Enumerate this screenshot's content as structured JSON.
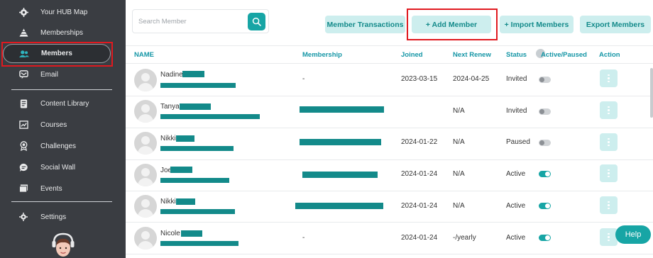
{
  "sidebar": {
    "items": [
      {
        "label": "Your HUB Map",
        "icon": "gear-icon"
      },
      {
        "label": "Memberships",
        "icon": "pyramid-icon"
      },
      {
        "label": "Members",
        "icon": "users-icon"
      },
      {
        "label": "Email",
        "icon": "email-icon"
      },
      {
        "label": "Content Library",
        "icon": "document-icon"
      },
      {
        "label": "Courses",
        "icon": "courses-icon"
      },
      {
        "label": "Challenges",
        "icon": "award-icon"
      },
      {
        "label": "Social Wall",
        "icon": "chat-icon"
      },
      {
        "label": "Events",
        "icon": "events-icon"
      },
      {
        "label": "Settings",
        "icon": "settings-icon"
      }
    ]
  },
  "search": {
    "placeholder": "Search Member"
  },
  "toolbar": {
    "transactions": "Member Transactions",
    "add": "+ Add Member",
    "import": "+ Import Members",
    "export": "Export Members"
  },
  "table": {
    "headers": {
      "name": "NAME",
      "membership": "Membership",
      "joined": "Joined",
      "renew": "Next Renew",
      "status": "Status",
      "active": "Active/Paused",
      "action": "Action"
    },
    "rows": [
      {
        "name": "Nadine",
        "membership": "-",
        "joined": "2023-03-15",
        "renew": "2024-04-25",
        "status": "Invited",
        "active": false
      },
      {
        "name": "Tanya",
        "membership": "",
        "joined": "",
        "renew": "N/A",
        "status": "Invited",
        "active": false
      },
      {
        "name": "Nikki",
        "membership": "",
        "joined": "2024-01-22",
        "renew": "N/A",
        "status": "Paused",
        "active": false
      },
      {
        "name": "Joe",
        "membership": "",
        "joined": "2024-01-24",
        "renew": "N/A",
        "status": "Active",
        "active": true
      },
      {
        "name": "Nikki",
        "membership": "",
        "joined": "2024-01-24",
        "renew": "N/A",
        "status": "Active",
        "active": true
      },
      {
        "name": "Nicole",
        "membership": "-",
        "joined": "2024-01-24",
        "renew": "-/yearly",
        "status": "Active",
        "active": true
      }
    ]
  },
  "help": {
    "label": "Help"
  },
  "colors": {
    "accent": "#17a5a5",
    "sidebar": "#3a3d42",
    "highlight": "#e0191f"
  }
}
